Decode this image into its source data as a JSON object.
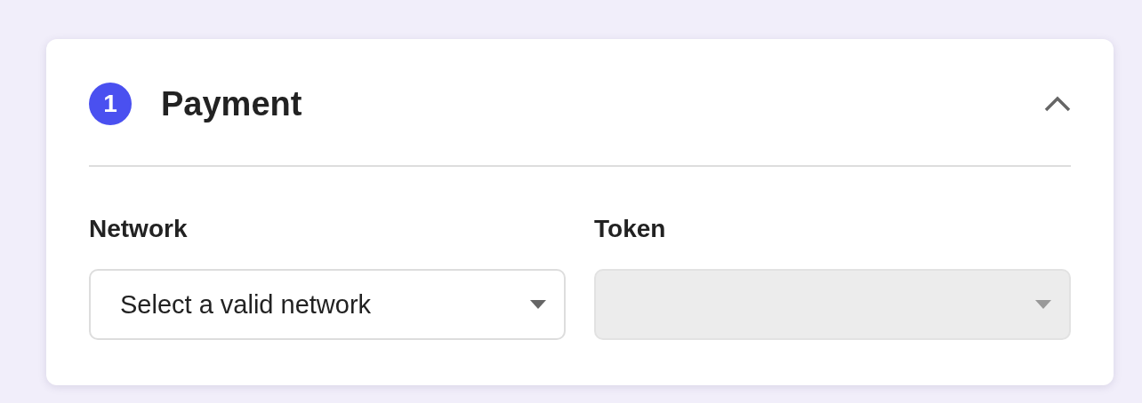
{
  "section": {
    "step": "1",
    "title": "Payment",
    "expanded": true
  },
  "fields": [
    {
      "label": "Network",
      "placeholder": "Select a valid network",
      "disabled": false
    },
    {
      "label": "Token",
      "disabled": true
    }
  ]
}
